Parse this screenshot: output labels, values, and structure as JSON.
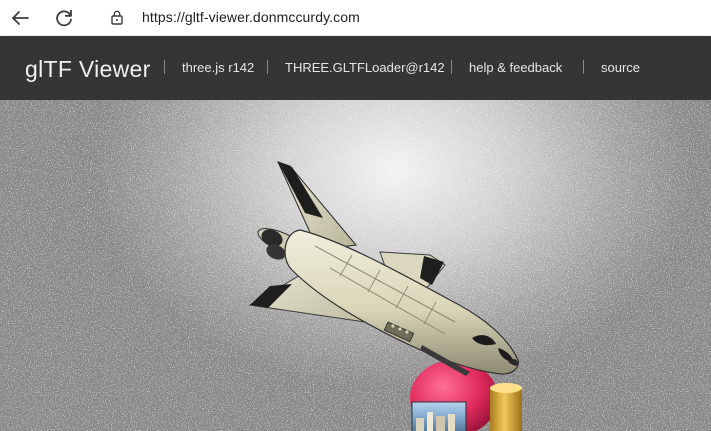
{
  "browser": {
    "url": "https://gltf-viewer.donmccurdy.com",
    "back_icon": "arrow-left-icon",
    "reload_icon": "reload-icon",
    "lock_icon": "lock-icon"
  },
  "header": {
    "title": "glTF Viewer",
    "links": [
      {
        "label": "three.js r142"
      },
      {
        "label": "THREE.GLTFLoader@r142"
      },
      {
        "label": "help & feedback"
      },
      {
        "label": "source"
      }
    ],
    "background": "#353535"
  },
  "viewport": {
    "model": "space shuttle",
    "background": "#bdbdbd"
  }
}
